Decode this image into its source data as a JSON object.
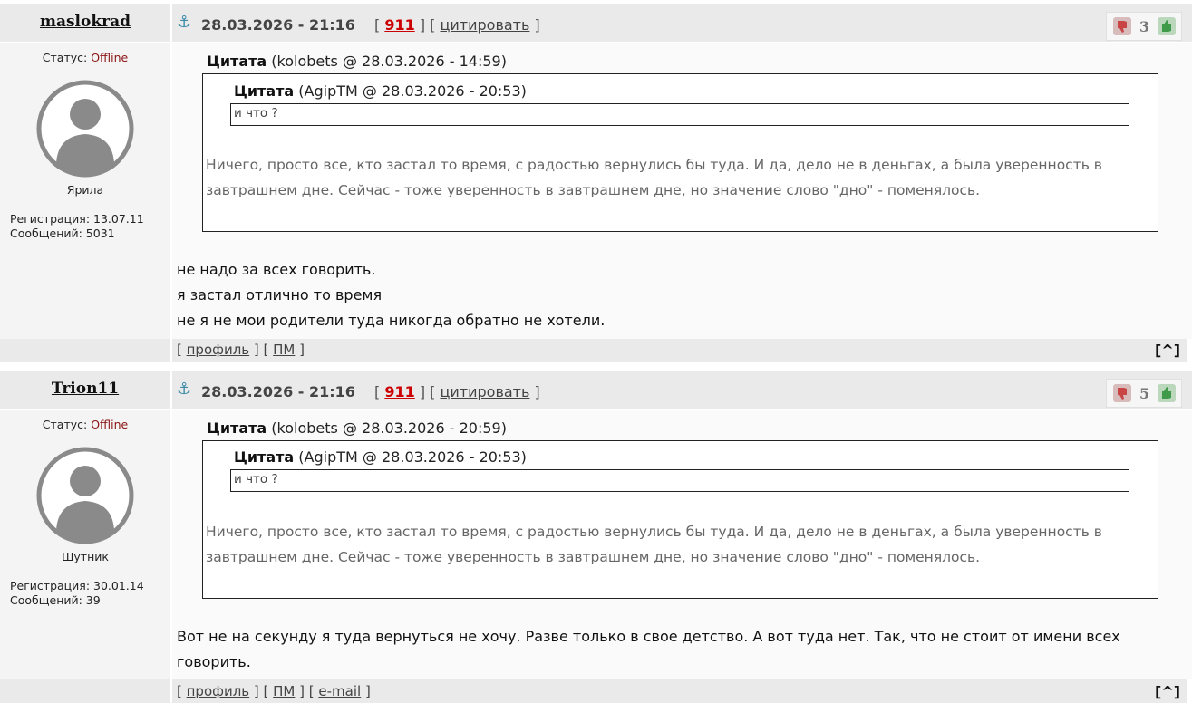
{
  "posts": [
    {
      "username": "maslokrad",
      "status_label": "Статус:",
      "status_value": "Offline",
      "rank": "Ярила",
      "registration": "Регистрация: 13.07.11",
      "messages": "Сообщений: 5031",
      "date": "28.03.2026 - 21:16",
      "post_number": "911",
      "quote_link": "цитировать",
      "vote_count": "3",
      "quote_outer_author": "(kolobets @ 28.03.2026 - 14:59)",
      "quote_inner_author": "(AgipTM @ 28.03.2026 - 20:53)",
      "quote_inner_text": "и что ?",
      "quote_outer_text": "Ничего, просто все, кто застал то время, с радостью вернулись бы туда. И да, дело не в деньгах, а была уверенность в завтрашнем дне. Сейчас - тоже уверенность в завтрашнем дне, но значение слово \"дно\" - поменялось.",
      "body_lines": [
        "не надо за всех говорить.",
        "я застал отлично то время",
        "не я не мои родители туда никогда обратно не хотели."
      ],
      "footer_links": [
        "профиль",
        "ПМ"
      ]
    },
    {
      "username": "Trion11",
      "status_label": "Статус:",
      "status_value": "Offline",
      "rank": "Шутник",
      "registration": "Регистрация: 30.01.14",
      "messages": "Сообщений: 39",
      "date": "28.03.2026 - 21:16",
      "post_number": "911",
      "quote_link": "цитировать",
      "vote_count": "5",
      "quote_outer_author": "(kolobets @ 28.03.2026 - 20:59)",
      "quote_inner_author": "(AgipTM @ 28.03.2026 - 20:53)",
      "quote_inner_text": "и что ?",
      "quote_outer_text": "Ничего, просто все, кто застал то время, с радостью вернулись бы туда. И да, дело не в деньгах, а была уверенность в завтрашнем дне. Сейчас - тоже уверенность в завтрашнем дне, но значение слово \"дно\" - поменялось.",
      "body_lines": [
        "Вот не на секунду я туда вернуться не хочу. Разве только в свое детство. А вот туда нет. Так, что не стоит от имени всех говорить."
      ],
      "footer_links": [
        "профиль",
        "ПМ",
        "e-mail"
      ]
    }
  ],
  "labels": {
    "quote_title": "Цитата",
    "to_top": "[^]"
  },
  "colors": {
    "header_bg": "#eaeaea",
    "offline": "#8b1414",
    "post_number": "#cc0000"
  }
}
